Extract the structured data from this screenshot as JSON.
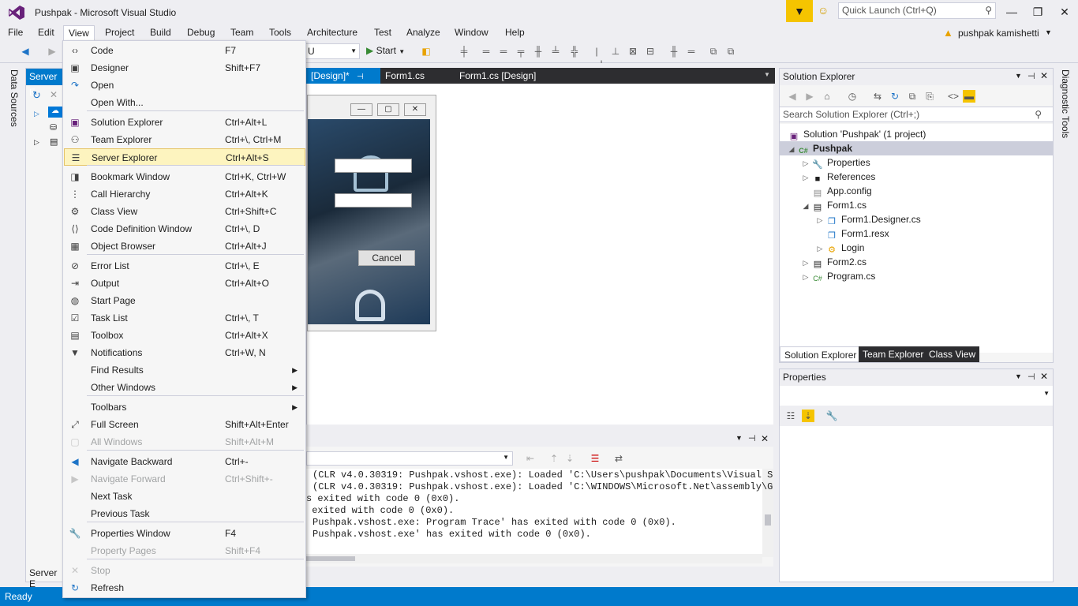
{
  "window": {
    "title": "Pushpak - Microsoft Visual Studio",
    "quick_launch_placeholder": "Quick Launch (Ctrl+Q)",
    "user": "pushpak kamishetti"
  },
  "menu": [
    "File",
    "Edit",
    "View",
    "Project",
    "Build",
    "Debug",
    "Team",
    "Tools",
    "Architecture",
    "Test",
    "Analyze",
    "Window",
    "Help"
  ],
  "toolbar": {
    "config_value": "U",
    "start_label": "Start"
  },
  "left_tabs": {
    "data_sources": "Data Sources",
    "server_explorer_short": "Server E",
    "server_explorer_bottom": "Server E"
  },
  "right_tabs": {
    "diagnostic_tools": "Diagnostic Tools"
  },
  "doc_tabs": [
    "[Design]*",
    "Form1.cs",
    "Form1.cs [Design]"
  ],
  "form_designer": {
    "cancel_button": "Cancel"
  },
  "view_menu": [
    {
      "label": "Code",
      "shortcut": "F7",
      "icon": "code-icon"
    },
    {
      "label": "Designer",
      "shortcut": "Shift+F7",
      "icon": "designer-icon"
    },
    {
      "label": "Open",
      "shortcut": "",
      "icon": "open-icon"
    },
    {
      "label": "Open With...",
      "shortcut": "",
      "icon": ""
    },
    {
      "label": "Solution Explorer",
      "shortcut": "Ctrl+Alt+L",
      "icon": "solution-explorer-icon"
    },
    {
      "label": "Team Explorer",
      "shortcut": "Ctrl+\\, Ctrl+M",
      "icon": "team-explorer-icon"
    },
    {
      "label": "Server Explorer",
      "shortcut": "Ctrl+Alt+S",
      "icon": "server-explorer-icon"
    },
    {
      "label": "Bookmark Window",
      "shortcut": "Ctrl+K, Ctrl+W",
      "icon": "bookmark-icon"
    },
    {
      "label": "Call Hierarchy",
      "shortcut": "Ctrl+Alt+K",
      "icon": "call-hierarchy-icon"
    },
    {
      "label": "Class View",
      "shortcut": "Ctrl+Shift+C",
      "icon": "class-view-icon"
    },
    {
      "label": "Code Definition Window",
      "shortcut": "Ctrl+\\, D",
      "icon": "code-definition-icon"
    },
    {
      "label": "Object Browser",
      "shortcut": "Ctrl+Alt+J",
      "icon": "object-browser-icon"
    },
    {
      "label": "Error List",
      "shortcut": "Ctrl+\\, E",
      "icon": "error-list-icon"
    },
    {
      "label": "Output",
      "shortcut": "Ctrl+Alt+O",
      "icon": "output-icon"
    },
    {
      "label": "Start Page",
      "shortcut": "",
      "icon": "start-page-icon"
    },
    {
      "label": "Task List",
      "shortcut": "Ctrl+\\, T",
      "icon": "task-list-icon"
    },
    {
      "label": "Toolbox",
      "shortcut": "Ctrl+Alt+X",
      "icon": "toolbox-icon"
    },
    {
      "label": "Notifications",
      "shortcut": "Ctrl+W, N",
      "icon": "notifications-icon"
    },
    {
      "label": "Find Results",
      "shortcut": "",
      "icon": ""
    },
    {
      "label": "Other Windows",
      "shortcut": "",
      "icon": ""
    },
    {
      "label": "Toolbars",
      "shortcut": "",
      "icon": ""
    },
    {
      "label": "Full Screen",
      "shortcut": "Shift+Alt+Enter",
      "icon": "full-screen-icon"
    },
    {
      "label": "All Windows",
      "shortcut": "Shift+Alt+M",
      "icon": "all-windows-icon"
    },
    {
      "label": "Navigate Backward",
      "shortcut": "Ctrl+-",
      "icon": "navigate-backward-icon"
    },
    {
      "label": "Navigate Forward",
      "shortcut": "Ctrl+Shift+-",
      "icon": "navigate-forward-icon"
    },
    {
      "label": "Next Task",
      "shortcut": "",
      "icon": ""
    },
    {
      "label": "Previous Task",
      "shortcut": "",
      "icon": ""
    },
    {
      "label": "Properties Window",
      "shortcut": "F4",
      "icon": "properties-window-icon"
    },
    {
      "label": "Property Pages",
      "shortcut": "Shift+F4",
      "icon": ""
    },
    {
      "label": "Stop",
      "shortcut": "",
      "icon": "stop-icon"
    },
    {
      "label": "Refresh",
      "shortcut": "",
      "icon": "refresh-icon"
    }
  ],
  "solution_explorer": {
    "title": "Solution Explorer",
    "search_placeholder": "Search Solution Explorer (Ctrl+;)",
    "tree": [
      "Solution 'Pushpak' (1 project)",
      "Pushpak",
      "Properties",
      "References",
      "App.config",
      "Form1.cs",
      "Form1.Designer.cs",
      "Form1.resx",
      "Login",
      "Form2.cs",
      "Program.cs"
    ],
    "bottom_tabs": [
      "Solution Explorer",
      "Team Explorer",
      "Class View"
    ]
  },
  "properties": {
    "title": "Properties"
  },
  "output": {
    "lines": [
      "(CLR v4.0.30319: Pushpak.vshost.exe): Loaded 'C:\\Users\\pushpak\\Documents\\Visual S",
      "(CLR v4.0.30319: Pushpak.vshost.exe): Loaded 'C:\\WINDOWS\\Microsoft.Net\\assembly\\G",
      "s exited with code 0 (0x0).",
      " exited with code 0 (0x0).",
      "Pushpak.vshost.exe: Program Trace' has exited with code 0 (0x0).",
      "Pushpak.vshost.exe' has exited with code 0 (0x0)."
    ]
  },
  "status": {
    "text": "Ready"
  },
  "colors": {
    "accent": "#007acc",
    "highlight": "#fdf4bf"
  }
}
